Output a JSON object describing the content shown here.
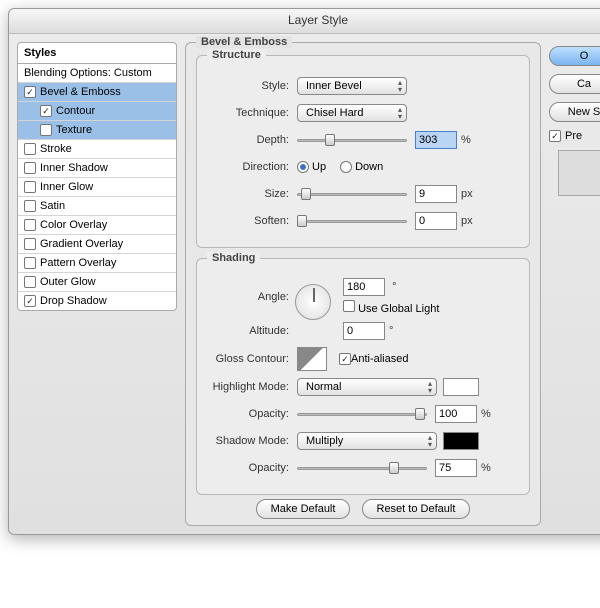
{
  "window": {
    "title": "Layer Style"
  },
  "sidebar": {
    "header": "Styles",
    "blending": "Blending Options: Custom",
    "items": [
      {
        "label": "Bevel & Emboss",
        "checked": true,
        "selected": true
      },
      {
        "label": "Contour",
        "checked": true,
        "selected": true,
        "sub": true
      },
      {
        "label": "Texture",
        "checked": false,
        "selected": true,
        "sub": true
      },
      {
        "label": "Stroke",
        "checked": false
      },
      {
        "label": "Inner Shadow",
        "checked": false
      },
      {
        "label": "Inner Glow",
        "checked": false
      },
      {
        "label": "Satin",
        "checked": false
      },
      {
        "label": "Color Overlay",
        "checked": false
      },
      {
        "label": "Gradient Overlay",
        "checked": false
      },
      {
        "label": "Pattern Overlay",
        "checked": false
      },
      {
        "label": "Outer Glow",
        "checked": false
      },
      {
        "label": "Drop Shadow",
        "checked": true
      }
    ]
  },
  "panel": {
    "title": "Bevel & Emboss"
  },
  "structure": {
    "legend": "Structure",
    "style_label": "Style:",
    "style_value": "Inner Bevel",
    "technique_label": "Technique:",
    "technique_value": "Chisel Hard",
    "depth_label": "Depth:",
    "depth_value": "303",
    "depth_unit": "%",
    "direction_label": "Direction:",
    "up": "Up",
    "down": "Down",
    "size_label": "Size:",
    "size_value": "9",
    "size_unit": "px",
    "soften_label": "Soften:",
    "soften_value": "0",
    "soften_unit": "px"
  },
  "shading": {
    "legend": "Shading",
    "angle_label": "Angle:",
    "angle_value": "180",
    "degree": "°",
    "global_light": "Use Global Light",
    "altitude_label": "Altitude:",
    "altitude_value": "0",
    "gloss_label": "Gloss Contour:",
    "antialiased": "Anti-aliased",
    "highlight_mode_label": "Highlight Mode:",
    "highlight_mode_value": "Normal",
    "opacity_label": "Opacity:",
    "highlight_opacity": "100",
    "shadow_mode_label": "Shadow Mode:",
    "shadow_mode_value": "Multiply",
    "shadow_opacity": "75",
    "pct": "%"
  },
  "buttons": {
    "make_default": "Make Default",
    "reset_default": "Reset to Default",
    "ok": "O",
    "cancel": "Ca",
    "new_style": "New S",
    "preview": "Pre"
  }
}
